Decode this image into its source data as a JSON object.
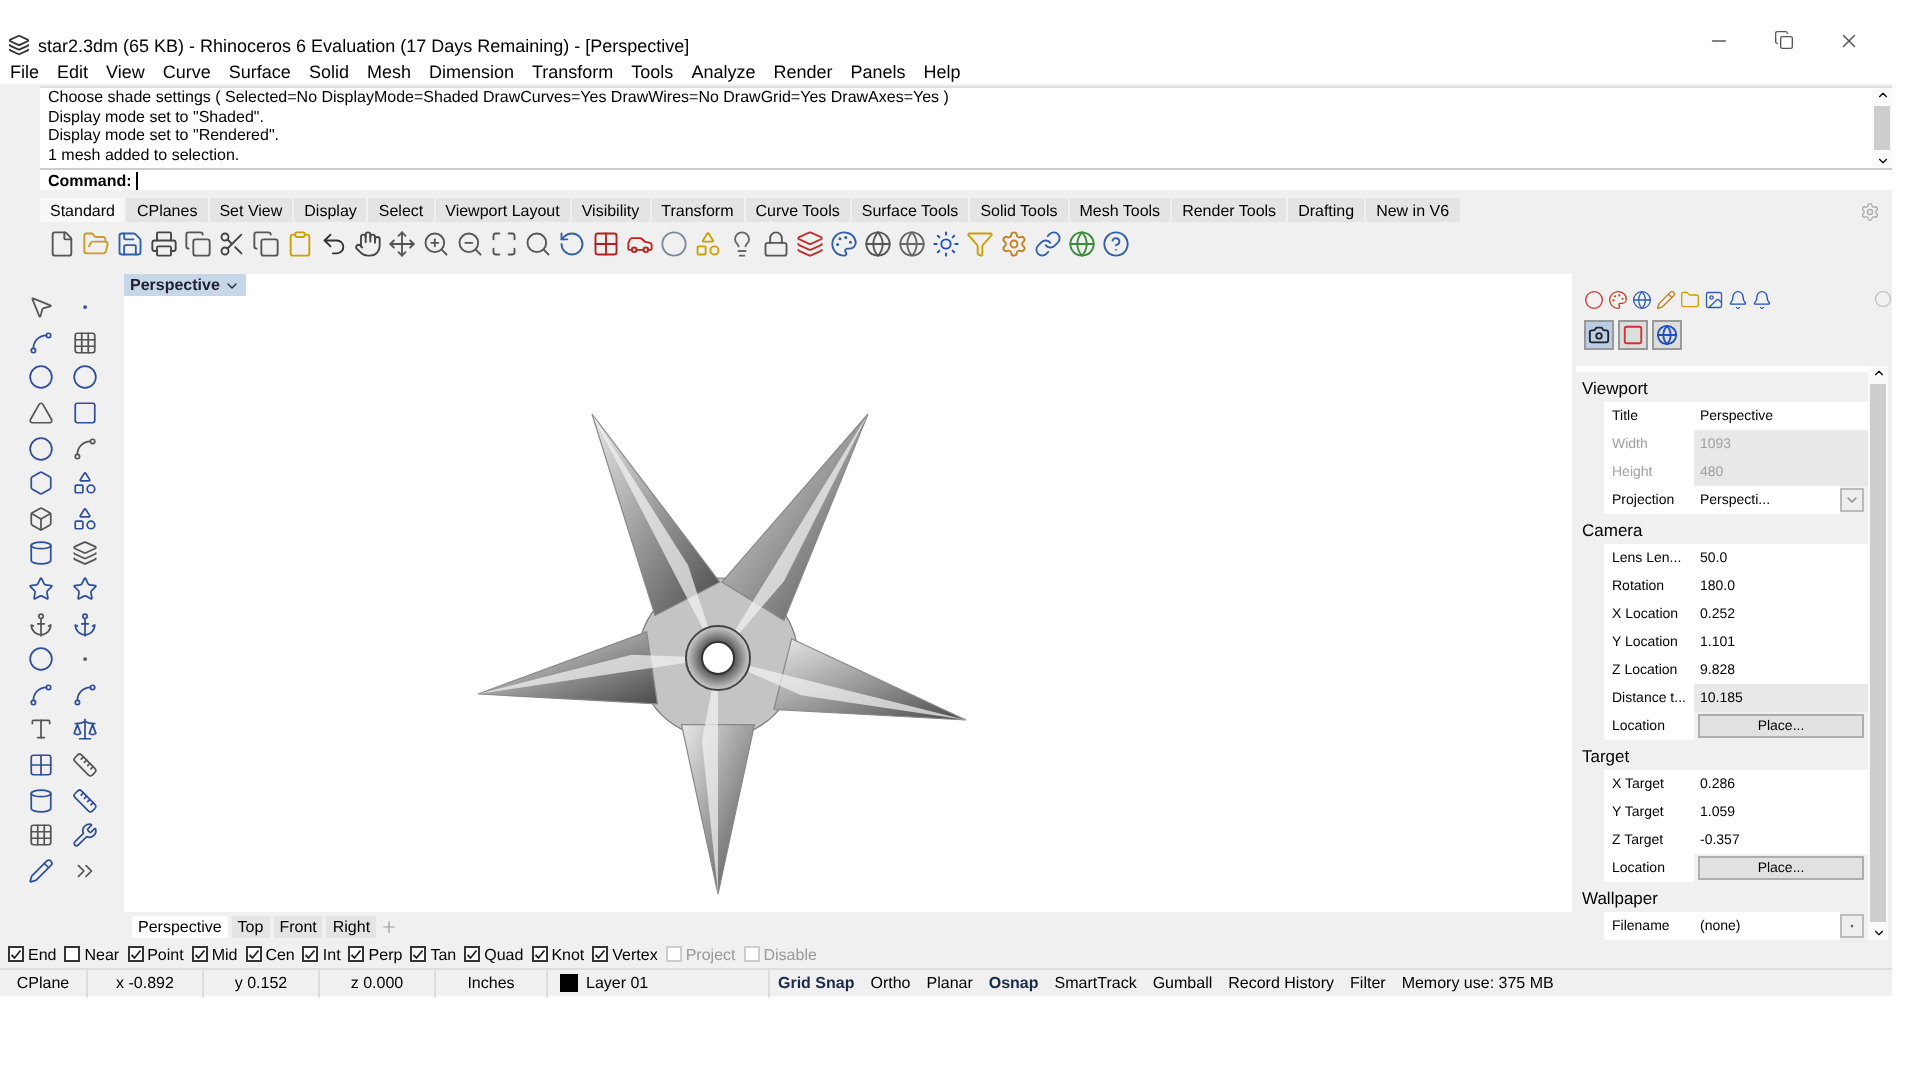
{
  "window": {
    "title": "star2.3dm (65 KB) - Rhinoceros 6 Evaluation (17 Days Remaining) - [Perspective]"
  },
  "menu": [
    "File",
    "Edit",
    "View",
    "Curve",
    "Surface",
    "Solid",
    "Mesh",
    "Dimension",
    "Transform",
    "Tools",
    "Analyze",
    "Render",
    "Panels",
    "Help"
  ],
  "command_history": [
    "Choose shade settings ( Selected=No DisplayMode=Shaded DrawCurves=Yes DrawWires=No DrawGrid=Yes DrawAxes=Yes )",
    "Display mode set to \"Shaded\".",
    "Display mode set to \"Rendered\".",
    "1 mesh added to selection."
  ],
  "command_prompt": {
    "label": "Command:"
  },
  "toolbar_tabs": [
    {
      "label": "Standard",
      "selected": true
    },
    {
      "label": "CPlanes",
      "selected": false
    },
    {
      "label": "Set View",
      "selected": false
    },
    {
      "label": "Display",
      "selected": false
    },
    {
      "label": "Select",
      "selected": false
    },
    {
      "label": "Viewport Layout",
      "selected": false
    },
    {
      "label": "Visibility",
      "selected": false
    },
    {
      "label": "Transform",
      "selected": false
    },
    {
      "label": "Curve Tools",
      "selected": false
    },
    {
      "label": "Surface Tools",
      "selected": false
    },
    {
      "label": "Solid Tools",
      "selected": false
    },
    {
      "label": "Mesh Tools",
      "selected": false
    },
    {
      "label": "Render Tools",
      "selected": false
    },
    {
      "label": "Drafting",
      "selected": false
    },
    {
      "label": "New in V6",
      "selected": false
    }
  ],
  "viewport": {
    "title": "Perspective"
  },
  "viewport_tabs": [
    {
      "label": "Perspective",
      "selected": true
    },
    {
      "label": "Top",
      "selected": false
    },
    {
      "label": "Front",
      "selected": false
    },
    {
      "label": "Right",
      "selected": false
    }
  ],
  "properties": [
    {
      "section": "Viewport",
      "rows": [
        {
          "label": "Title",
          "value": "Perspective",
          "kind": "text",
          "disabled": false
        },
        {
          "label": "Width",
          "value": "1093",
          "kind": "text",
          "disabled": true
        },
        {
          "label": "Height",
          "value": "480",
          "kind": "text",
          "disabled": true
        },
        {
          "label": "Projection",
          "value": "Perspecti...",
          "kind": "dropdown",
          "disabled": false
        }
      ]
    },
    {
      "section": "Camera",
      "rows": [
        {
          "label": "Lens Len...",
          "value": "50.0",
          "kind": "text",
          "disabled": false
        },
        {
          "label": "Rotation",
          "value": "180.0",
          "kind": "text",
          "disabled": false
        },
        {
          "label": "X Location",
          "value": "0.252",
          "kind": "text",
          "disabled": false
        },
        {
          "label": "Y Location",
          "value": "1.101",
          "kind": "text",
          "disabled": false
        },
        {
          "label": "Z Location",
          "value": "9.828",
          "kind": "text",
          "disabled": false
        },
        {
          "label": "Distance t...",
          "value": "10.185",
          "kind": "readonly",
          "disabled": false
        },
        {
          "label": "Location",
          "value": "Place...",
          "kind": "button",
          "disabled": false
        }
      ]
    },
    {
      "section": "Target",
      "rows": [
        {
          "label": "X Target",
          "value": "0.286",
          "kind": "text",
          "disabled": false
        },
        {
          "label": "Y Target",
          "value": "1.059",
          "kind": "text",
          "disabled": false
        },
        {
          "label": "Z Target",
          "value": "-0.357",
          "kind": "text",
          "disabled": false
        },
        {
          "label": "Location",
          "value": "Place...",
          "kind": "button",
          "disabled": false
        }
      ]
    },
    {
      "section": "Wallpaper",
      "rows": [
        {
          "label": "Filename",
          "value": "(none)",
          "kind": "file",
          "disabled": false
        }
      ]
    }
  ],
  "osnaps": [
    {
      "label": "End",
      "checked": true,
      "disabled": false
    },
    {
      "label": "Near",
      "checked": false,
      "disabled": false
    },
    {
      "label": "Point",
      "checked": true,
      "disabled": false
    },
    {
      "label": "Mid",
      "checked": true,
      "disabled": false
    },
    {
      "label": "Cen",
      "checked": true,
      "disabled": false
    },
    {
      "label": "Int",
      "checked": true,
      "disabled": false
    },
    {
      "label": "Perp",
      "checked": true,
      "disabled": false
    },
    {
      "label": "Tan",
      "checked": true,
      "disabled": false
    },
    {
      "label": "Quad",
      "checked": true,
      "disabled": false
    },
    {
      "label": "Knot",
      "checked": true,
      "disabled": false
    },
    {
      "label": "Vertex",
      "checked": true,
      "disabled": false
    },
    {
      "label": "Project",
      "checked": false,
      "disabled": true
    },
    {
      "label": "Disable",
      "checked": false,
      "disabled": true
    }
  ],
  "status_bar": {
    "cplane": "CPlane",
    "x": "x -0.892",
    "y": "y 0.152",
    "z": "z 0.000",
    "units": "Inches",
    "layer": "Layer 01",
    "toggles": [
      {
        "label": "Grid Snap",
        "on": true
      },
      {
        "label": "Ortho",
        "on": false
      },
      {
        "label": "Planar",
        "on": false
      },
      {
        "label": "Osnap",
        "on": true
      },
      {
        "label": "SmartTrack",
        "on": false
      },
      {
        "label": "Gumball",
        "on": false
      },
      {
        "label": "Record History",
        "on": false
      },
      {
        "label": "Filter",
        "on": false
      }
    ],
    "memory": "Memory use: 375 MB"
  }
}
